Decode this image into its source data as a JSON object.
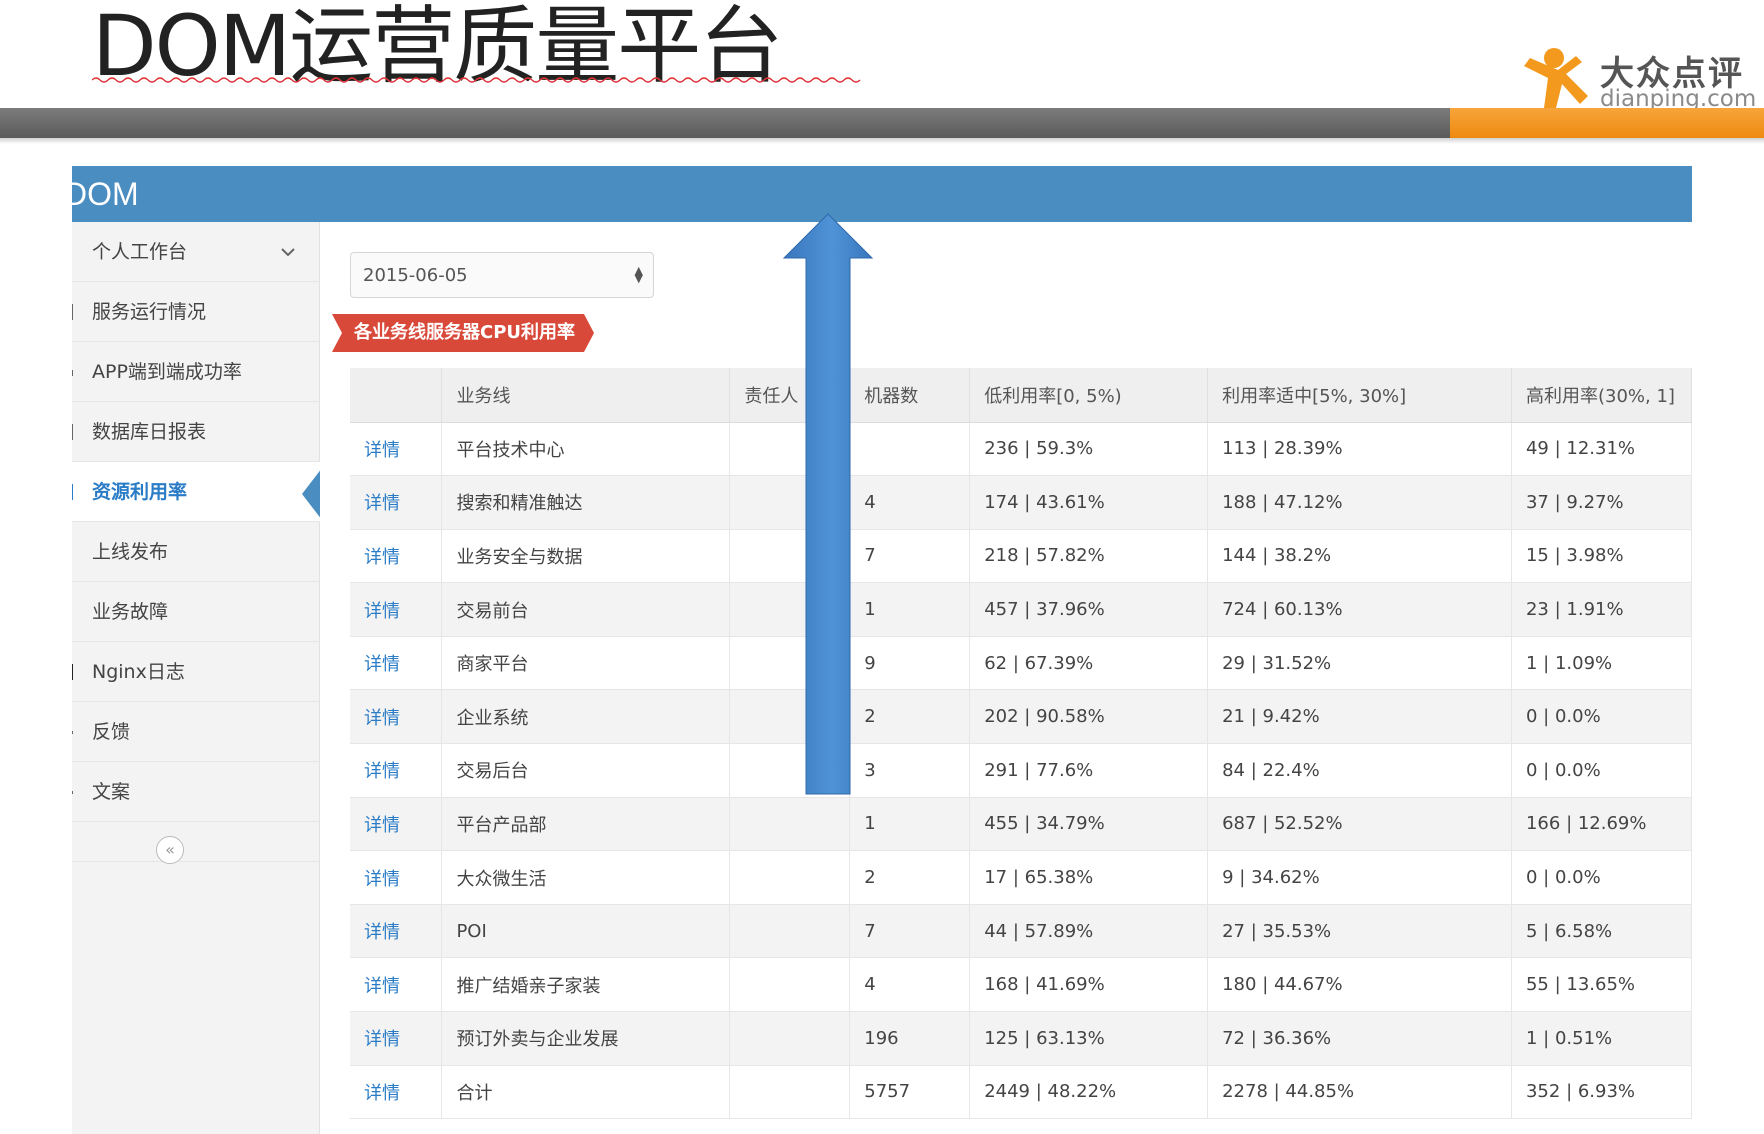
{
  "slide": {
    "title": "DOM运营质量平台",
    "logo_cn": "大众点评",
    "logo_en": "dianping.com",
    "colors": {
      "gray_bar": "#666666",
      "orange_bar": "#f39a1e",
      "app_header": "#4a8dc0",
      "red_value": "#e03a3a",
      "link": "#2a7cc7",
      "arrow": "#3d7fc4"
    }
  },
  "app": {
    "brand": "DOM",
    "sidebar": {
      "items": [
        {
          "label": "个人工作台",
          "has_chevron": true
        },
        {
          "label": "服务运行情况"
        },
        {
          "label": "APP端到端成功率"
        },
        {
          "label": "数据库日报表"
        },
        {
          "label": "资源利用率",
          "active": true
        },
        {
          "label": "上线发布"
        },
        {
          "label": "业务故障"
        },
        {
          "label": "Nginx日志"
        },
        {
          "label": "反馈"
        },
        {
          "label": "文案"
        }
      ],
      "collapse_glyph": "«"
    },
    "date_select": {
      "value": "2015-06-05"
    },
    "ribbon": {
      "text": "各业务线服务器CPU利用率"
    },
    "table": {
      "columns": [
        "",
        "业务线",
        "责任人",
        "机器数",
        "低利用率[0, 5%)",
        "利用率适中[5%, 30%]",
        "高利用率(30%, 1]"
      ],
      "rows": [
        {
          "link": "详情",
          "line": "平台技术中心",
          "owner": "",
          "machines": "",
          "low": "236 | 59.3%",
          "mid": "113 | 28.39%",
          "high": "49 | 12.31%"
        },
        {
          "link": "详情",
          "line": "搜索和精准触达",
          "owner": "",
          "machines": "4",
          "low": "174 | 43.61%",
          "mid": "188 | 47.12%",
          "high": "37 | 9.27%"
        },
        {
          "link": "详情",
          "line": "业务安全与数据",
          "owner": "",
          "machines": "7",
          "low": "218 | 57.82%",
          "mid": "144 | 38.2%",
          "high": "15 | 3.98%"
        },
        {
          "link": "详情",
          "line": "交易前台",
          "owner": "",
          "machines": "1",
          "low": "457 | 37.96%",
          "mid": "724 | 60.13%",
          "high": "23 | 1.91%"
        },
        {
          "link": "详情",
          "line": "商家平台",
          "owner": "",
          "machines": "9",
          "low": "62 | 67.39%",
          "mid": "29 | 31.52%",
          "high": "1 | 1.09%"
        },
        {
          "link": "详情",
          "line": "企业系统",
          "owner": "",
          "machines": "2",
          "low": "202 | 90.58%",
          "mid": "21 | 9.42%",
          "high": "0 | 0.0%"
        },
        {
          "link": "详情",
          "line": "交易后台",
          "owner": "",
          "machines": "3",
          "low": "291 | 77.6%",
          "mid": "84 | 22.4%",
          "high": "0 | 0.0%"
        },
        {
          "link": "详情",
          "line": "平台产品部",
          "owner": "",
          "machines": "1",
          "low": "455 | 34.79%",
          "mid": "687 | 52.52%",
          "high": "166 | 12.69%"
        },
        {
          "link": "详情",
          "line": "大众微生活",
          "owner": "",
          "machines": "2",
          "low": "17 | 65.38%",
          "mid": "9 | 34.62%",
          "high": "0 | 0.0%"
        },
        {
          "link": "详情",
          "line": "POI",
          "owner": "",
          "machines": "7",
          "low": "44 | 57.89%",
          "mid": "27 | 35.53%",
          "high": "5 | 6.58%"
        },
        {
          "link": "详情",
          "line": "推广结婚亲子家装",
          "owner": "",
          "machines": "4",
          "low": "168 | 41.69%",
          "mid": "180 | 44.67%",
          "high": "55 | 13.65%"
        },
        {
          "link": "详情",
          "line": "预订外卖与企业发展",
          "owner": "",
          "machines": "196",
          "low": "125 | 63.13%",
          "mid": "72 | 36.36%",
          "high": "1 | 0.51%"
        },
        {
          "link": "详情",
          "line": "合计",
          "owner": "",
          "machines": "5757",
          "low": "2449 | 48.22%",
          "mid": "2278 | 44.85%",
          "high": "352 | 6.93%"
        }
      ]
    },
    "annotation": {
      "arrow_direction": "up"
    }
  }
}
